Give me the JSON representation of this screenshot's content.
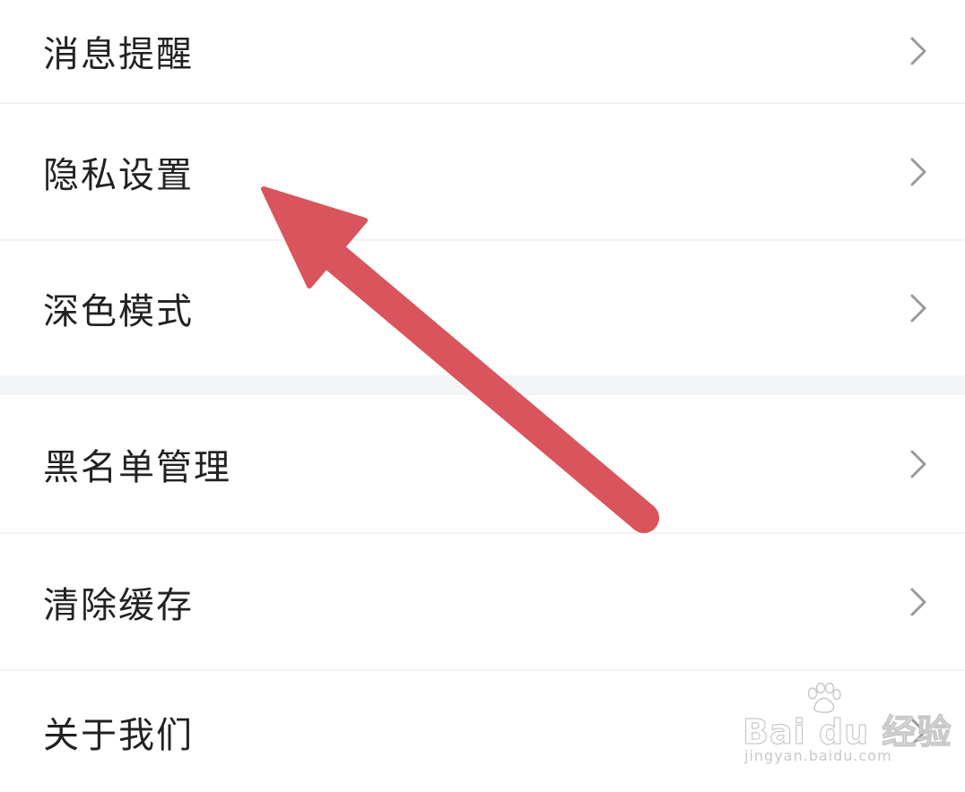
{
  "settings": {
    "group1": [
      {
        "label": "消息提醒"
      },
      {
        "label": "隐私设置"
      },
      {
        "label": "深色模式"
      }
    ],
    "group2": [
      {
        "label": "黑名单管理"
      },
      {
        "label": "清除缓存"
      },
      {
        "label": "关于我们"
      }
    ]
  },
  "icons": {
    "row_chevron": "chevron-right-icon",
    "annotation": "arrow-annotation"
  },
  "colors": {
    "text": "#222222",
    "chevron": "#9a9a9a",
    "divider": "#f1f2f4",
    "section_gap": "#f4f5f7",
    "annotation_arrow": "#d9545c"
  },
  "watermark": {
    "brand": "Bai du 经验",
    "url": "jingyan.baidu.com"
  }
}
